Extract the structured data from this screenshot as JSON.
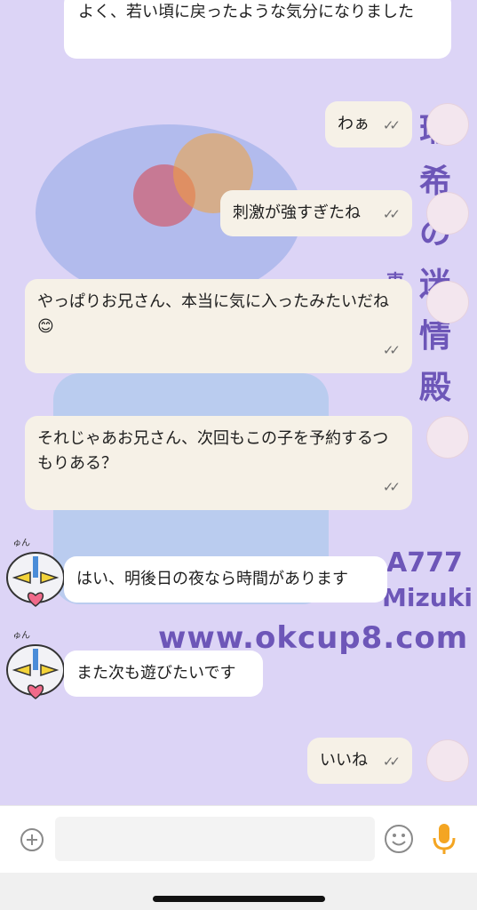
{
  "wallpaper": {
    "brand_line1": "A777",
    "brand_line2": "Mizuki",
    "website": "www.okcup8.com",
    "vertical_title": "瑞希の迷情殿",
    "vertical_sub": "東 デ"
  },
  "messages": [
    {
      "id": "m0",
      "side": "in",
      "text": "よく、若い頃に戻ったような気分になりました"
    },
    {
      "id": "m1",
      "side": "out",
      "text": "わぁ",
      "status": "read"
    },
    {
      "id": "m2",
      "side": "out",
      "text": "刺激が強すぎたね",
      "status": "read"
    },
    {
      "id": "m3",
      "side": "out",
      "text": "やっぱりお兄さん、本当に気に入ったみたいだね😊",
      "status": "read"
    },
    {
      "id": "m4",
      "side": "out",
      "text": "それじゃあお兄さん、次回もこの子を予約するつもりある？",
      "status": "read"
    },
    {
      "id": "m5",
      "side": "in",
      "text": "はい、明後日の夜なら時間があります"
    },
    {
      "id": "m6",
      "side": "in",
      "text": "また次も遊びたいです"
    },
    {
      "id": "m7",
      "side": "out",
      "text": "いいね",
      "status": "read"
    }
  ],
  "check_glyph": "✓✓",
  "composer": {
    "placeholder": "",
    "plus_icon": "plus-circle-icon",
    "emoji_icon": "smiley-icon",
    "mic_icon": "microphone-icon"
  },
  "colors": {
    "chat_bg": "#dcd4f6",
    "incoming_bubble": "#ffffff",
    "outgoing_bubble": "#f6f1e7",
    "mic_accent": "#f4a522",
    "wallpaper_purple": "#6d56b8"
  },
  "robot_sticker_text": "きゅん"
}
